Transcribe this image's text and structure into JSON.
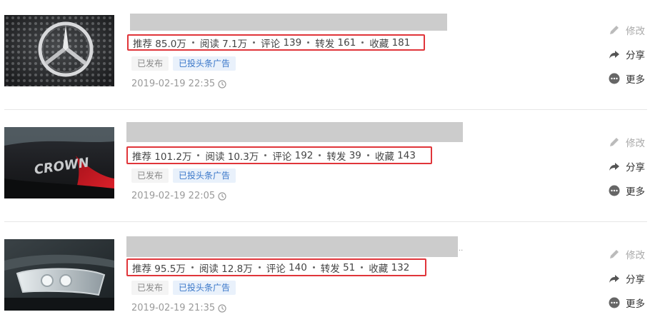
{
  "articles": [
    {
      "stats": [
        {
          "label": "推荐",
          "value": "85.0万"
        },
        {
          "label": "阅读",
          "value": "7.1万"
        },
        {
          "label": "评论",
          "value": "139"
        },
        {
          "label": "转发",
          "value": "161"
        },
        {
          "label": "收藏",
          "value": "181"
        }
      ],
      "tags": {
        "published": "已发布",
        "ad": "已投头条广告"
      },
      "time": "2019-02-19 22:35",
      "thumb_icon": "mercedes-emblem-photo"
    },
    {
      "stats": [
        {
          "label": "推荐",
          "value": "101.2万"
        },
        {
          "label": "阅读",
          "value": "10.3万"
        },
        {
          "label": "评论",
          "value": "192"
        },
        {
          "label": "转发",
          "value": "39"
        },
        {
          "label": "收藏",
          "value": "143"
        }
      ],
      "tags": {
        "published": "已发布",
        "ad": "已投头条广告"
      },
      "time": "2019-02-19 22:05",
      "thumb_icon": "crown-badge-photo",
      "thumb_text": "CROWN"
    },
    {
      "stats": [
        {
          "label": "推荐",
          "value": "95.5万"
        },
        {
          "label": "阅读",
          "value": "12.8万"
        },
        {
          "label": "评论",
          "value": "140"
        },
        {
          "label": "转发",
          "value": "51"
        },
        {
          "label": "收藏",
          "value": "132"
        }
      ],
      "tags": {
        "published": "已发布",
        "ad": "已投头条广告"
      },
      "time": "2019-02-19 21:35",
      "thumb_icon": "car-headlight-photo"
    }
  ],
  "actions": {
    "edit": "修改",
    "share": "分享",
    "more": "更多"
  },
  "colors": {
    "highlight_border": "#e0353a",
    "ad_tag_text": "#3a77c9",
    "ad_tag_bg": "#e9f1fb",
    "title_placeholder": "#cccccc"
  }
}
